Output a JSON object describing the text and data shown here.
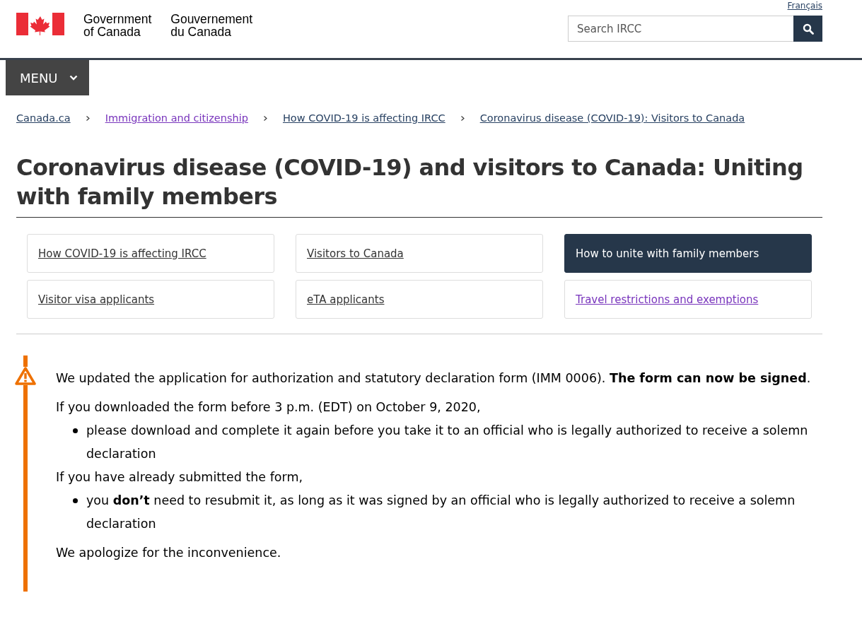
{
  "header": {
    "language_link": "Français",
    "signature_en": [
      "Government",
      "of Canada"
    ],
    "signature_fr": [
      "Gouvernement",
      "du Canada"
    ],
    "search": {
      "placeholder": "Search IRCC"
    }
  },
  "menu": {
    "label": "MENU"
  },
  "breadcrumbs": [
    {
      "label": "Canada.ca",
      "visited": false
    },
    {
      "label": "Immigration and citizenship",
      "visited": true
    },
    {
      "label": "How COVID-19 is affecting IRCC",
      "visited": false
    },
    {
      "label": "Coronavirus disease (COVID-19): Visitors to Canada",
      "visited": false
    }
  ],
  "title": "Coronavirus disease (COVID-19) and visitors to Canada: Uniting with family members",
  "tiles": [
    {
      "label": "How COVID-19 is affecting IRCC",
      "selected": false,
      "visited": false
    },
    {
      "label": "Visitors to Canada",
      "selected": false,
      "visited": false
    },
    {
      "label": "How to unite with family members",
      "selected": true,
      "visited": false
    },
    {
      "label": "Visitor visa applicants",
      "selected": false,
      "visited": false
    },
    {
      "label": "eTA applicants",
      "selected": false,
      "visited": false
    },
    {
      "label": "Travel restrictions and exemptions",
      "selected": false,
      "visited": true
    }
  ],
  "alert": {
    "blocks": [
      {
        "kind": "paragraph",
        "text": "We updated the application for authorization and statutory declaration form (IMM 0006). **The form can now be signed**."
      },
      {
        "kind": "line",
        "text": "If you downloaded the form before 3 p.m. (EDT) on October 9, 2020,"
      },
      {
        "kind": "bullet",
        "text": "please download and complete it again before you take it to an official who is legally authorized to receive a solemn declaration"
      },
      {
        "kind": "line",
        "text": "If you have already submitted the form,"
      },
      {
        "kind": "bullet",
        "text": "you **don’t** need to resubmit it, as long as it was signed by an official who is legally authorized to receive a solemn declaration"
      },
      {
        "kind": "paragraph",
        "text": "We apologize for the inconvenience."
      }
    ]
  }
}
